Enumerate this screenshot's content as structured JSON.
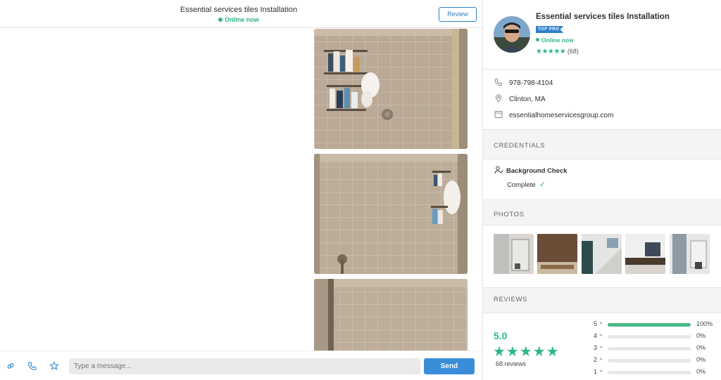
{
  "chat": {
    "title": "Essential services tiles Installation",
    "status": "Online now",
    "review_label": "Review",
    "message_placeholder": "Type a message...",
    "send_label": "Send"
  },
  "profile": {
    "name": "Essential services tiles Installation",
    "badge": "TOP PRO",
    "status": "Online now",
    "stars": "★★★★★",
    "review_count": "(68)",
    "phone": "978-798-4104",
    "location": "Clinton, MA",
    "website": "essentialhomeservicesgroup.com"
  },
  "credentials": {
    "heading": "CREDENTIALS",
    "item_label": "Background Check",
    "item_status": "Complete"
  },
  "photos": {
    "heading": "PHOTOS"
  },
  "reviews": {
    "heading": "REVIEWS",
    "rating": "5.0",
    "stars": "★★★★★",
    "count_label": "68 reviews",
    "breakdown": [
      {
        "stars": "5",
        "percent_label": "100%",
        "fraction": 1.0
      },
      {
        "stars": "4",
        "percent_label": "0%",
        "fraction": 0.0
      },
      {
        "stars": "3",
        "percent_label": "0%",
        "fraction": 0.0
      },
      {
        "stars": "2",
        "percent_label": "0%",
        "fraction": 0.0
      },
      {
        "stars": "1",
        "percent_label": "0%",
        "fraction": 0.0
      }
    ]
  },
  "colors": {
    "accent_green": "#2db783",
    "accent_blue": "#3a8ed9"
  },
  "icons": [
    "link-icon",
    "phone-icon",
    "star-icon",
    "location-icon",
    "website-icon",
    "person-check-icon"
  ]
}
